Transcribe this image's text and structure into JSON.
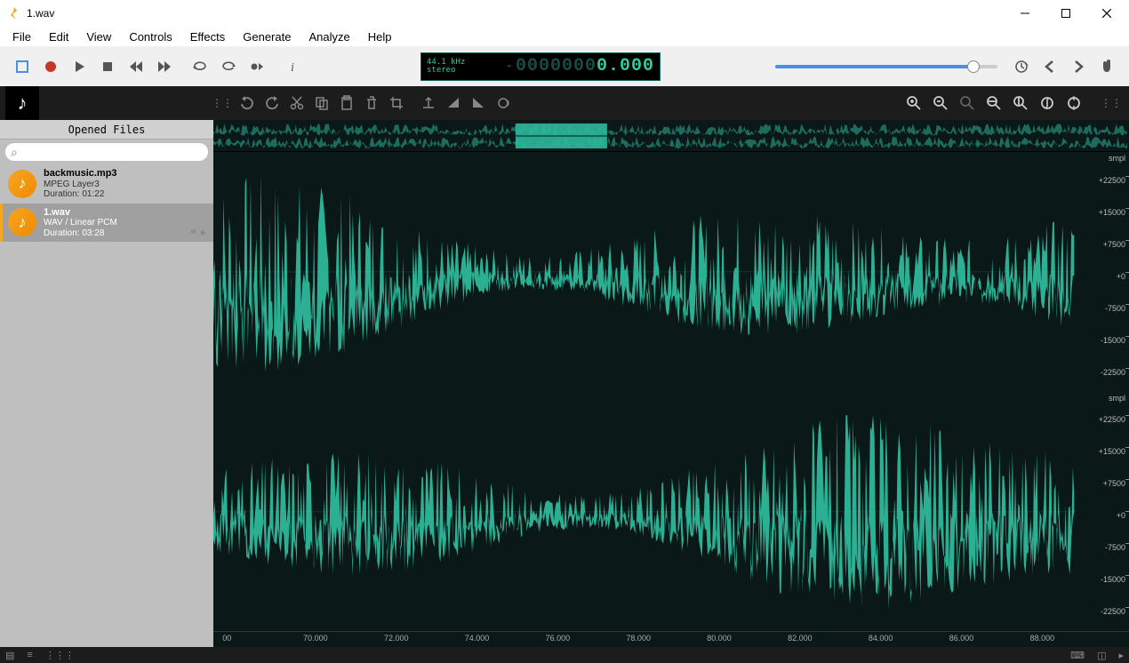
{
  "window": {
    "title": "1.wav"
  },
  "menu": [
    "File",
    "Edit",
    "View",
    "Controls",
    "Effects",
    "Generate",
    "Analyze",
    "Help"
  ],
  "transport": {
    "sample_rate": "44.1 kHz",
    "channels_label": "stereo",
    "time_dim": "0000000",
    "time_value": "0.000"
  },
  "sidebar": {
    "header": "Opened Files",
    "search_placeholder": "",
    "files": [
      {
        "name": "backmusic.mp3",
        "format": "MPEG Layer3",
        "duration": "Duration: 01:22",
        "selected": false
      },
      {
        "name": "1.wav",
        "format": "WAV / Linear PCM",
        "duration": "Duration: 03:28",
        "selected": true
      }
    ]
  },
  "ruler_y": {
    "ch_label": "smpl",
    "ticks": [
      "+22500",
      "+15000",
      "+7500",
      "+0",
      "-7500",
      "-15000",
      "-22500"
    ]
  },
  "timeline": {
    "labels": [
      "00",
      "70.000",
      "72.000",
      "74.000",
      "76.000",
      "78.000",
      "80.000",
      "82.000",
      "84.000",
      "86.000",
      "88.000"
    ]
  },
  "icons": {
    "record_color": "#c0392b",
    "wave_color": "#2eb89a"
  }
}
